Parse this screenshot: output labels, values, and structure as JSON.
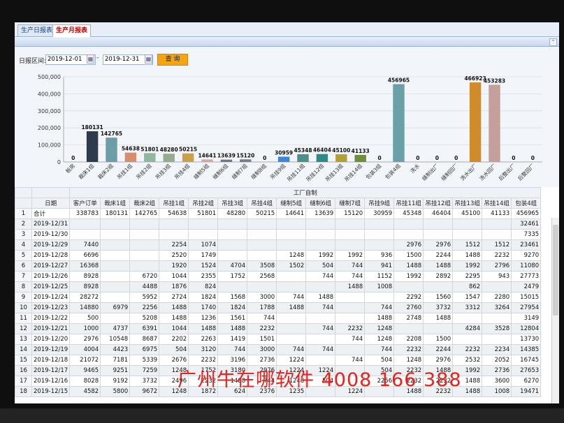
{
  "tabs": [
    {
      "label": "生产日报表",
      "active": false
    },
    {
      "label": "生产月报表",
      "active": true
    }
  ],
  "filter": {
    "label": "日报区间:",
    "start": "2019-12-01",
    "end": "2019-12-31",
    "query_label": "查 询"
  },
  "chart_data": {
    "type": "bar",
    "categories": [
      "板房",
      "裁床1组",
      "裁床2组",
      "吊挂1组",
      "吊挂2组",
      "吊挂3组",
      "吊挂4组",
      "缝制5组",
      "缝制6组",
      "缝制7组",
      "缝制8组",
      "吊挂9组",
      "吊挂11组",
      "吊挂12组",
      "吊挂13组",
      "吊挂14组",
      "包装3组",
      "包装4组",
      "洗水",
      "缝制出厂",
      "缝制回厂",
      "洗水出厂",
      "洗水回厂",
      "后整出厂",
      "后整回厂"
    ],
    "values": [
      0,
      180131,
      142765,
      54638,
      51801,
      48280,
      50215,
      14641,
      13639,
      15120,
      0,
      30959,
      45348,
      46404,
      45100,
      41133,
      0,
      456965,
      0,
      0,
      0,
      466923,
      453283,
      0,
      0
    ],
    "colors": [
      "#2d3b4c",
      "#2d3b4c",
      "#6b9ea7",
      "#d98d6d",
      "#8fb89e",
      "#93ad8e",
      "#c9a04c",
      "#d6a6a0",
      "#6a7a8a",
      "#6f7d8c",
      "#6f7d8c",
      "#3a86d8",
      "#4e8f8a",
      "#2d8a86",
      "#b2a035",
      "#6f8e3c",
      "#6f8e3c",
      "#6aa1a9",
      "#6aa1a9",
      "#6aa1a9",
      "#6aa1a9",
      "#d08c2b",
      "#c4a09a",
      "#c4a09a",
      "#c4a09a"
    ],
    "ylim": [
      0,
      500000
    ],
    "yticks": [
      "0",
      "100,000",
      "200,000",
      "300,000",
      "400,000",
      "500,000"
    ],
    "ytick_values": [
      0,
      100000,
      200000,
      300000,
      400000,
      500000
    ],
    "grid": true
  },
  "table": {
    "group_header": "工厂自制",
    "columns": [
      "日期",
      "客户订单",
      "裁床1组",
      "裁床2组",
      "吊挂1组",
      "吊挂2组",
      "吊挂3组",
      "吊挂4组",
      "缝制5组",
      "缝制6组",
      "缝制7组",
      "吊挂9组",
      "吊挂11组",
      "吊挂12组",
      "吊挂13组",
      "吊挂14组",
      "包装4组"
    ],
    "rows": [
      [
        "1",
        "合计",
        "338783",
        "180131",
        "142765",
        "54638",
        "51801",
        "48280",
        "50215",
        "14641",
        "13639",
        "15120",
        "30959",
        "45348",
        "46404",
        "45100",
        "41133",
        "456965"
      ],
      [
        "2",
        "2019-12/31",
        "",
        "",
        "",
        "",
        "",
        "",
        "",
        "",
        "",
        "",
        "",
        "",
        "",
        "",
        "",
        "32461"
      ],
      [
        "3",
        "2019-12/30",
        "",
        "",
        "",
        "",
        "",
        "",
        "",
        "",
        "",
        "",
        "",
        "",
        "",
        "",
        "",
        "7335"
      ],
      [
        "4",
        "2019-12/29",
        "7440",
        "",
        "",
        "2254",
        "1074",
        "",
        "",
        "",
        "",
        "",
        "",
        "2976",
        "2976",
        "1512",
        "1512",
        "23461"
      ],
      [
        "5",
        "2019-12/28",
        "6696",
        "",
        "",
        "2520",
        "1749",
        "",
        "",
        "1248",
        "1992",
        "1992",
        "936",
        "1500",
        "2244",
        "1488",
        "2232",
        "9270"
      ],
      [
        "6",
        "2019-12/27",
        "16368",
        "",
        "",
        "1920",
        "1524",
        "4704",
        "3508",
        "1502",
        "504",
        "744",
        "941",
        "1488",
        "1488",
        "1992",
        "2796",
        "11080"
      ],
      [
        "7",
        "2019-12/26",
        "8928",
        "",
        "6720",
        "1044",
        "2355",
        "1752",
        "2568",
        "",
        "744",
        "744",
        "1152",
        "1992",
        "2892",
        "2295",
        "943",
        "27773"
      ],
      [
        "8",
        "2019-12/25",
        "8928",
        "",
        "4488",
        "1876",
        "824",
        "",
        "",
        "",
        "",
        "1488",
        "1008",
        "",
        "",
        "862",
        "",
        "2479"
      ],
      [
        "9",
        "2019-12/24",
        "28272",
        "",
        "5952",
        "2724",
        "1824",
        "1568",
        "3000",
        "744",
        "1488",
        "",
        "",
        "2292",
        "1560",
        "1547",
        "2280",
        "15015"
      ],
      [
        "10",
        "2019-12/23",
        "14880",
        "6979",
        "2256",
        "1488",
        "1740",
        "1824",
        "1788",
        "1488",
        "744",
        "",
        "744",
        "2760",
        "3732",
        "3312",
        "3264",
        "27954"
      ],
      [
        "11",
        "2019-12/22",
        "500",
        "",
        "5208",
        "1488",
        "1236",
        "1561",
        "744",
        "",
        "",
        "",
        "1488",
        "2748",
        "1488",
        "",
        "",
        "3149"
      ],
      [
        "12",
        "2019-12/21",
        "1000",
        "4737",
        "6391",
        "1044",
        "1488",
        "1488",
        "2232",
        "",
        "744",
        "2232",
        "1248",
        "",
        "",
        "4284",
        "3528",
        "12804"
      ],
      [
        "13",
        "2019-12/20",
        "2976",
        "10548",
        "8687",
        "2202",
        "2263",
        "1419",
        "1501",
        "",
        "",
        "744",
        "1248",
        "2208",
        "1500",
        "",
        "",
        "13730"
      ],
      [
        "14",
        "2019-12/19",
        "4004",
        "4423",
        "6975",
        "504",
        "3120",
        "744",
        "3000",
        "744",
        "744",
        "",
        "744",
        "2232",
        "2244",
        "2232",
        "2234",
        "14385"
      ],
      [
        "15",
        "2019-12/18",
        "21072",
        "7181",
        "5339",
        "2676",
        "2232",
        "3196",
        "2736",
        "1224",
        "",
        "744",
        "504",
        "1248",
        "2976",
        "2532",
        "2052",
        "16745"
      ],
      [
        "16",
        "2019-12/17",
        "9465",
        "9251",
        "7259",
        "1248",
        "1752",
        "3180",
        "2976",
        "1224",
        "1224",
        "",
        "504",
        "2232",
        "1488",
        "1992",
        "2736",
        "27653"
      ],
      [
        "17",
        "2019-12/16",
        "8028",
        "9192",
        "3732",
        "2496",
        "2232",
        "1488",
        "744",
        "1248",
        "504",
        "",
        "2256",
        "2232",
        "2232",
        "1488",
        "3600",
        "6270"
      ],
      [
        "18",
        "2019-12/15",
        "4582",
        "5800",
        "9672",
        "1248",
        "1872",
        "624",
        "2376",
        "1235",
        "",
        "1224",
        "",
        "1488",
        "2232",
        "1488",
        "1008",
        "19471"
      ]
    ]
  },
  "watermark": "广州牛在哪软件 4008 166 388"
}
